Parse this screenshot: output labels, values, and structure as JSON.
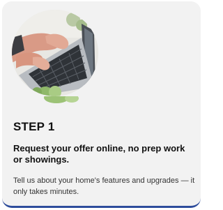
{
  "step": {
    "label": "STEP 1",
    "heading": "Request your offer online, no prep work or showings.",
    "description": "Tell us about your home's features and upgrades — it only takes minutes."
  },
  "image": {
    "icon": "laptop-typing-photo",
    "accent_color": "#2e4d9c"
  }
}
